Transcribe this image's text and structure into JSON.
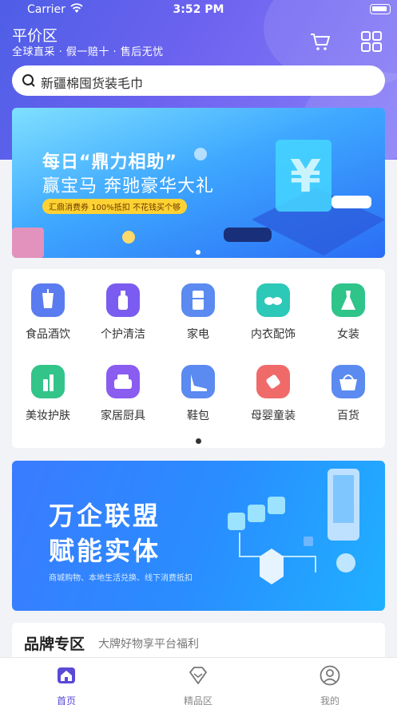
{
  "status_bar": {
    "carrier": "Carrier",
    "time": "3:52 PM"
  },
  "header": {
    "title": "平价区",
    "subtitle": "全球直采 · 假一赔十 · 售后无忧",
    "icons": [
      "cart-icon",
      "grid-menu-icon"
    ]
  },
  "search": {
    "text": "新疆棉囤货装毛巾"
  },
  "banner1": {
    "title": "每日“鼎力相助”",
    "subtitle": "赢宝马  奔驰豪华大礼",
    "tag": "汇鼎消费券 100%抵扣 不花钱买个够"
  },
  "categories": [
    {
      "label": "食品酒饮",
      "icon": "cup-icon",
      "color": "#5b7cf0"
    },
    {
      "label": "个护清洁",
      "icon": "bottle-icon",
      "color": "#7b5cf0"
    },
    {
      "label": "家电",
      "icon": "fridge-icon",
      "color": "#5b8af0"
    },
    {
      "label": "内衣配饰",
      "icon": "bra-icon",
      "color": "#2cc8b8"
    },
    {
      "label": "女装",
      "icon": "dress-icon",
      "color": "#2ec48a"
    },
    {
      "label": "美妆护肤",
      "icon": "lipstick-icon",
      "color": "#33c48a"
    },
    {
      "label": "家居厨具",
      "icon": "sofa-icon",
      "color": "#8a5cf0"
    },
    {
      "label": "鞋包",
      "icon": "heel-icon",
      "color": "#5b8af0"
    },
    {
      "label": "母婴童装",
      "icon": "pacifier-icon",
      "color": "#f06a6a"
    },
    {
      "label": "百货",
      "icon": "basket-icon",
      "color": "#5b8af0"
    }
  ],
  "banner2": {
    "title": "万企联盟",
    "subtitle": "赋能实体",
    "caption": "商城购物、本地生活兑换、线下消费抵扣"
  },
  "brand": {
    "title": "品牌专区",
    "subtitle": "大牌好物享平台福利"
  },
  "tabbar": [
    {
      "label": "首页",
      "icon": "home-icon",
      "active": true
    },
    {
      "label": "精品区",
      "icon": "diamond-icon",
      "active": false
    },
    {
      "label": "我的",
      "icon": "user-icon",
      "active": false
    }
  ]
}
